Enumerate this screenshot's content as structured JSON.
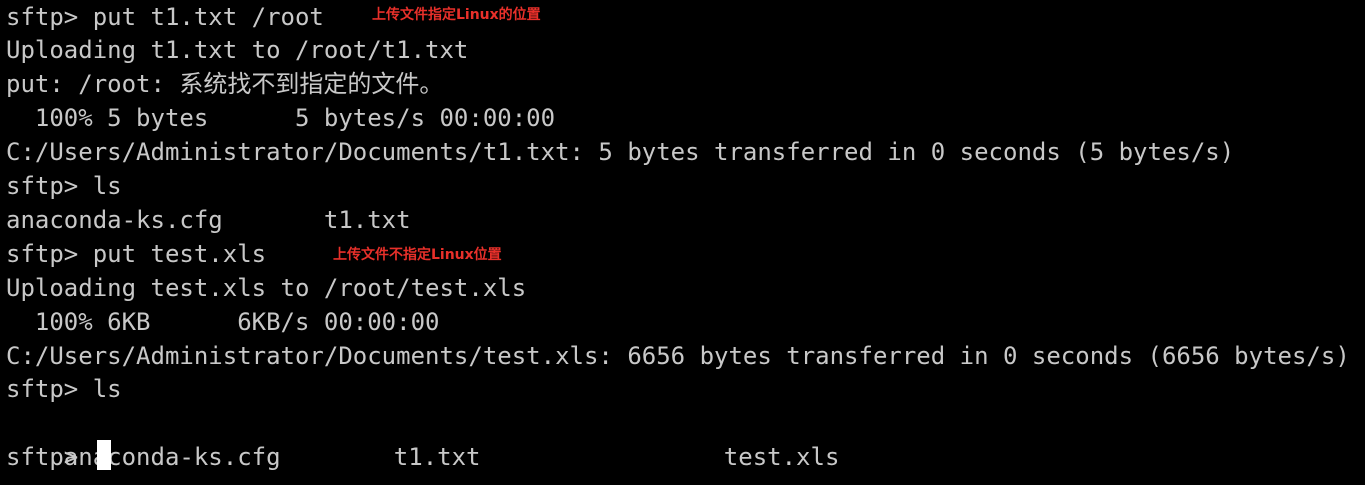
{
  "terminal": {
    "lines": [
      "sftp> put t1.txt /root",
      "Uploading t1.txt to /root/t1.txt",
      "put: /root: 系统找不到指定的文件。",
      "  100% 5 bytes      5 bytes/s 00:00:00",
      "C:/Users/Administrator/Documents/t1.txt: 5 bytes transferred in 0 seconds (5 bytes/s)",
      "sftp> ls",
      "anaconda-ks.cfg       t1.txt",
      "sftp> put test.xls",
      "Uploading test.xls to /root/test.xls",
      "  100% 6KB      6KB/s 00:00:00",
      "C:/Users/Administrator/Documents/test.xls: 6656 bytes transferred in 0 seconds (6656 bytes/s)",
      "sftp> ls",
      "",
      "sftp> "
    ],
    "ls_listing": {
      "col1": "anaconda-ks.cfg",
      "col2": "t1.txt",
      "col3": "test.xls"
    }
  },
  "annotations": {
    "upload_with_path": "上传文件指定Linux的位置",
    "upload_without_path": "上传文件不指定Linux位置"
  },
  "colors": {
    "background": "#000000",
    "text": "#c8c8c8",
    "annotation": "#e8302a",
    "cursor": "#ffffff"
  }
}
